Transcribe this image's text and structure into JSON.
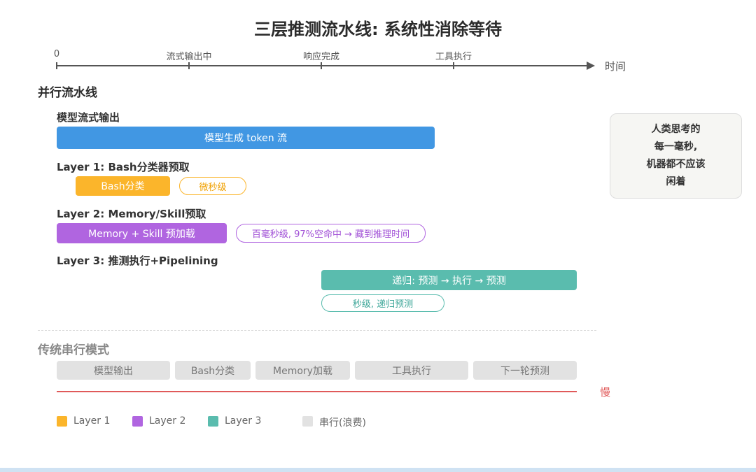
{
  "title": "三层推测流水线: 系统性消除等待",
  "timeline": {
    "ticks": [
      "0",
      "流式输出中",
      "响应完成",
      "工具执行"
    ],
    "end_label": "时间"
  },
  "parallel": {
    "heading": "并行流水线",
    "model": {
      "title": "模型流式输出",
      "bar": "模型生成 token 流",
      "color": "#4197e3"
    },
    "layer1": {
      "title": "Layer 1: Bash分类器预取",
      "bar": "Bash分类",
      "note": "微秒级",
      "color": "#fbb52b"
    },
    "layer2": {
      "title": "Layer 2: Memory/Skill预取",
      "bar": "Memory + Skill 预加载",
      "note": "百毫秒级, 97%空命中 → 藏到推理时间",
      "color": "#b065e0"
    },
    "layer3": {
      "title": "Layer 3: 推测执行+Pipelining",
      "bar": "递归: 预测 → 执行 → 预测",
      "note": "秒级, 递归预测",
      "color": "#5abcae"
    }
  },
  "note_box": {
    "lines": [
      "人类思考的",
      "每一毫秒,",
      "机器都不应该",
      "闲着"
    ]
  },
  "serial": {
    "heading": "传统串行模式",
    "blocks": [
      "模型输出",
      "Bash分类",
      "Memory加载",
      "工具执行",
      "下一轮预测"
    ],
    "slow_label": "慢",
    "line_color": "#e05a5a"
  },
  "legend": [
    {
      "label": "Layer 1",
      "color": "#fbb52b"
    },
    {
      "label": "Layer 2",
      "color": "#b065e0"
    },
    {
      "label": "Layer 3",
      "color": "#5abcae"
    },
    {
      "label": "串行(浪费)",
      "color": "#e2e2e2"
    }
  ]
}
